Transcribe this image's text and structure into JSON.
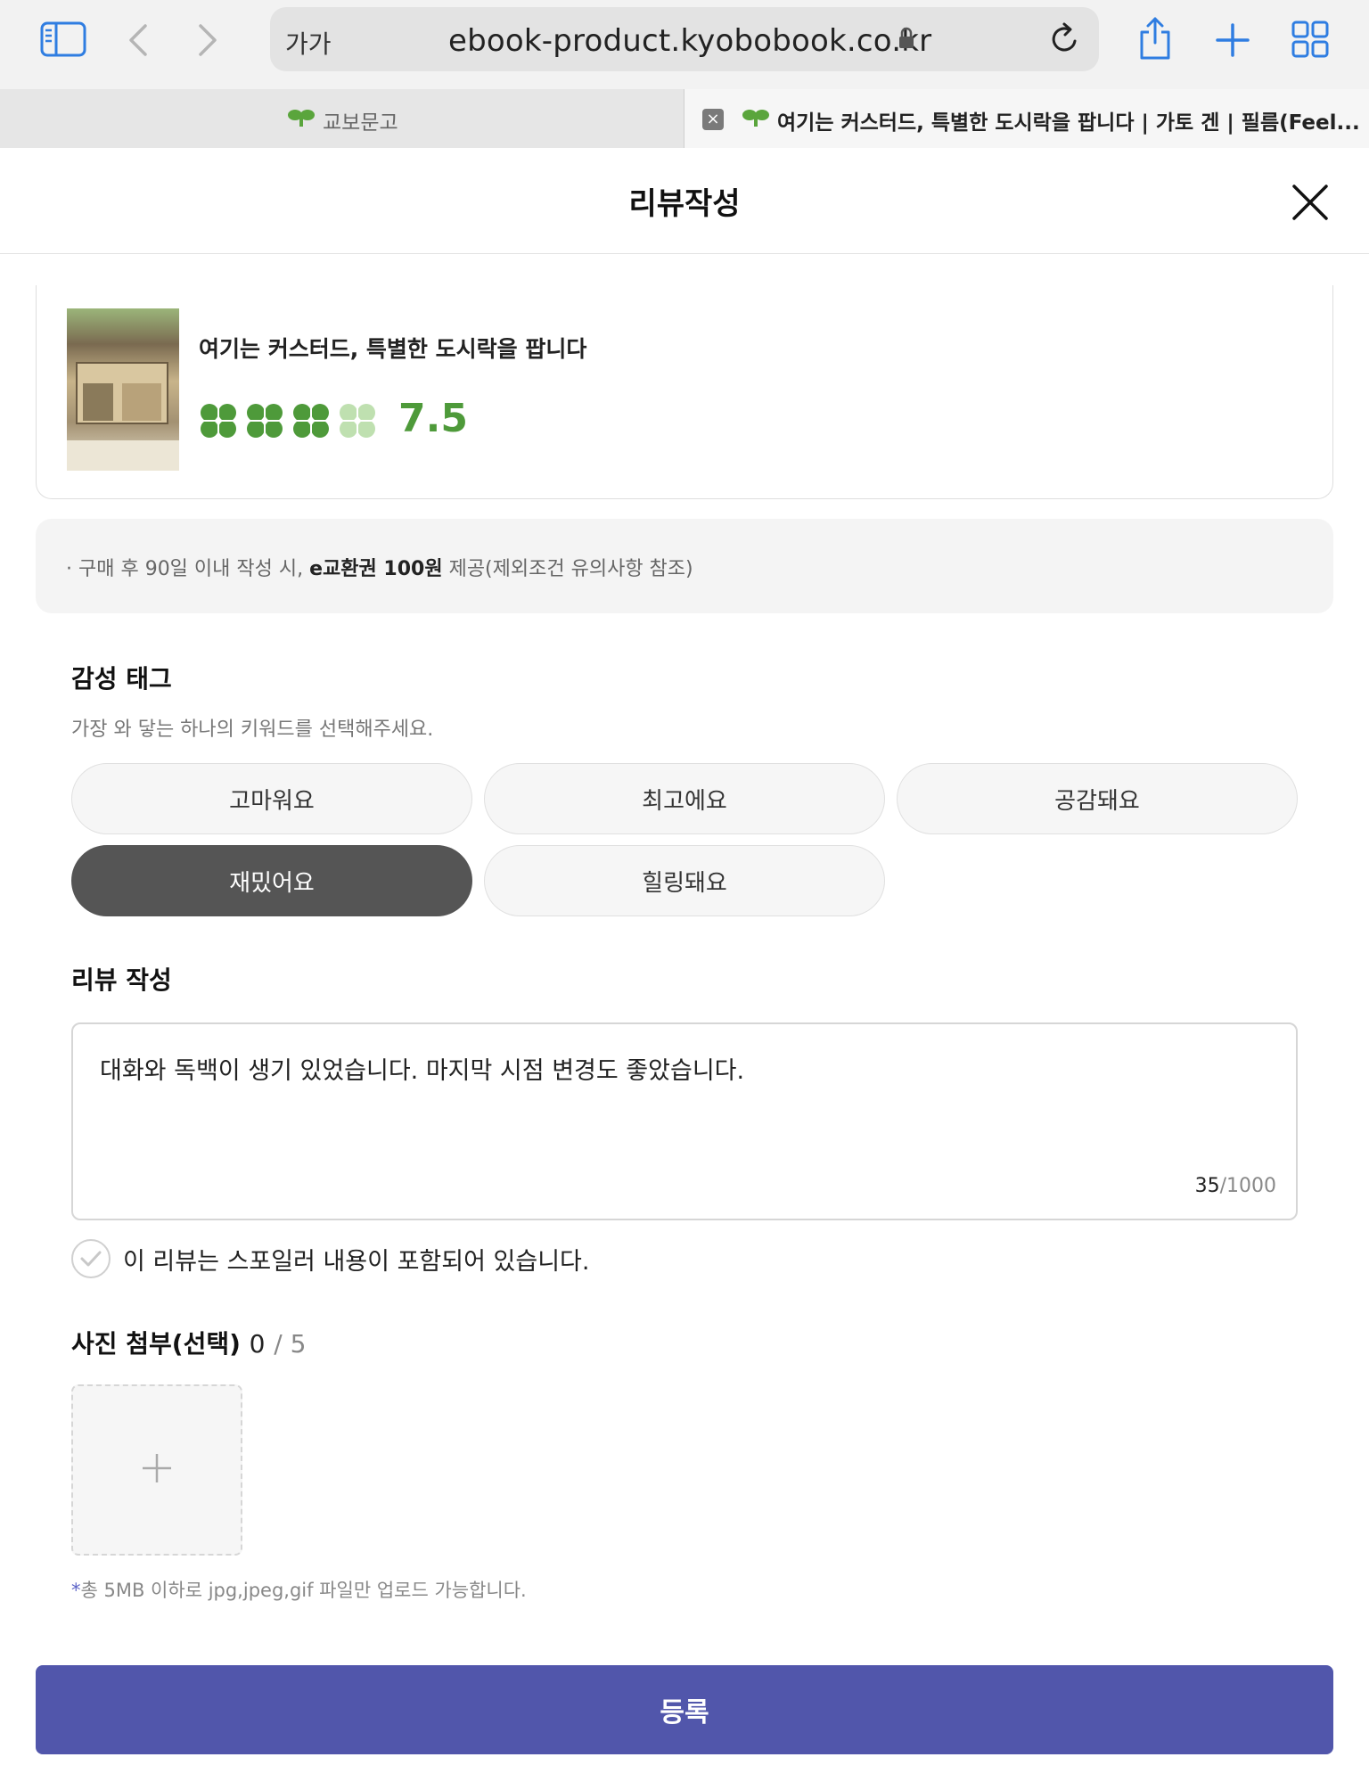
{
  "browser": {
    "text_size_label": "가가",
    "url": "ebook-product.kyobobook.co.kr",
    "tabs": [
      {
        "label": "교보문고"
      },
      {
        "label": "여기는 커스터드, 특별한 도시락을 팝니다 | 가토 겐 | 필름(Feel..."
      }
    ],
    "icons": [
      "sidebar-icon",
      "back-icon",
      "forward-icon",
      "lock-icon",
      "reload-icon",
      "share-icon",
      "new-tab-icon",
      "tabs-overview-icon"
    ]
  },
  "header": {
    "title": "리뷰작성"
  },
  "book": {
    "title": "여기는 커스터드, 특별한 도시락을 팝니다",
    "rating": "7.5",
    "clovers_filled": 3,
    "clovers_total": 4,
    "accent_color": "#4e9a3a"
  },
  "notice": {
    "prefix": "· 구매 후 90일 이내 작성 시,",
    "highlight": "e교환권 100원",
    "suffix": "제공(제외조건 유의사항 참조)"
  },
  "emotion_tags": {
    "title": "감성 태그",
    "subtitle": "가장 와 닿는 하나의 키워드를 선택해주세요.",
    "options": [
      "고마워요",
      "최고에요",
      "공감돼요",
      "재밌어요",
      "힐링돼요"
    ],
    "selected": "재밌어요"
  },
  "review": {
    "title": "리뷰 작성",
    "text": "대화와 독백이 생기 있었습니다. 마지막 시점 변경도 좋았습니다.",
    "count": "35",
    "max": "/1000"
  },
  "spoiler": {
    "label": "이 리뷰는 스포일러 내용이 포함되어 있습니다."
  },
  "photo": {
    "title": "사진 첨부(선택)",
    "count": "0",
    "max": "/ 5",
    "note_star": "*",
    "note": "총 5MB 이하로 jpg,jpeg,gif 파일만 업로드 가능합니다."
  },
  "submit_label": "등록",
  "colors": {
    "submit_bg": "#5156ab",
    "selected_tag_bg": "#555555"
  }
}
